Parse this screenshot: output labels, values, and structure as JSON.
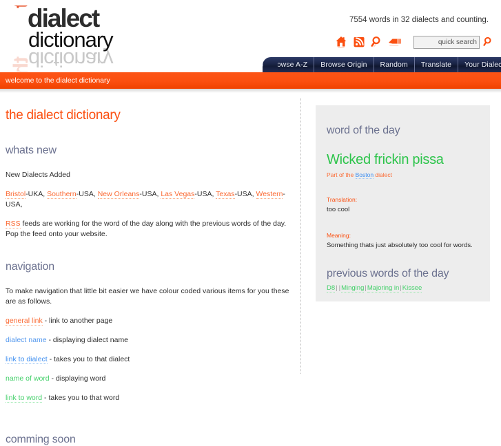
{
  "header": {
    "logo": {
      "the": "the",
      "dialect": "dialect",
      "dictionary": "dictionary"
    },
    "word_count_text": "7554 words in 32 dialects and counting.",
    "util_icons": [
      {
        "name": "home-icon",
        "label": "Home"
      },
      {
        "name": "rss-icon",
        "label": "RSS Feed"
      },
      {
        "name": "search-icon",
        "label": "Search"
      },
      {
        "name": "tag-icon",
        "label": "Tags"
      }
    ],
    "search": {
      "placeholder": "quick search",
      "value": "",
      "go_icon": "search-icon"
    },
    "nav": [
      {
        "label": "Browse A-Z"
      },
      {
        "label": "Browse Origin"
      },
      {
        "label": "Random"
      },
      {
        "label": "Translate"
      },
      {
        "label": "Your Dialect"
      }
    ]
  },
  "welcome_bar": {
    "text": "welcome to the dialect dictionary"
  },
  "main": {
    "page_title": "the dialect dictionary",
    "whats_new": {
      "heading": "whats new",
      "subheading": "New Dialects Added",
      "dialects": [
        {
          "link": "Bristol",
          "suffix": "-UKA,"
        },
        {
          "link": "Southern",
          "suffix": "-USA,"
        },
        {
          "link": "New Orleans",
          "suffix": "-USA,"
        },
        {
          "link": "Las Vegas",
          "suffix": "-USA,"
        },
        {
          "link": "Texas",
          "suffix": "-USA,"
        },
        {
          "link": "Western",
          "suffix": "-USA,"
        }
      ],
      "rss_link": "RSS",
      "rss_text": " feeds are working for the word of the day along with the previous words of the day. Pop the feed onto your website."
    },
    "navigation": {
      "heading": "navigation",
      "intro": "To make navigation that little bit easier we have colour coded various items for you these are as follows.",
      "legend": [
        {
          "link": "general link",
          "desc": " - link to another page",
          "style": "link-general"
        },
        {
          "link": "dialect name",
          "desc": " - displaying dialect name",
          "style": "link-dialect-name"
        },
        {
          "link": "link to dialect",
          "desc": " - takes you to that dialect",
          "style": "link-dialect"
        },
        {
          "link": "name of word",
          "desc": " - displaying word",
          "style": "link-word-name"
        },
        {
          "link": "link to word",
          "desc": " - takes you to that word",
          "style": "link-word"
        }
      ]
    },
    "coming_soon": {
      "heading": "comming soon"
    }
  },
  "sidebar": {
    "word_of_the_day": {
      "heading": "word of the day",
      "word": "Wicked frickin pissa",
      "part_of_prefix": "Part of the ",
      "dialect_link": "Boston",
      "part_of_suffix": " dialect",
      "translation_label": "Translation:",
      "translation_value": "too cool",
      "meaning_label": "Meaning:",
      "meaning_value": "Something thats just absolutely too cool for words."
    },
    "previous_words": {
      "heading": "previous words of the day",
      "words": [
        "D8",
        "",
        "Minging",
        "Majoring in",
        "Kissee"
      ],
      "separator": "|"
    }
  },
  "colors": {
    "brand_orange": "#fb4f10",
    "nav_navy": "#1b2547",
    "heading_slate": "#6b718f",
    "word_green": "#2cc44a",
    "dialect_blue": "#3d8ef0",
    "sidebar_bg": "#ededed"
  }
}
